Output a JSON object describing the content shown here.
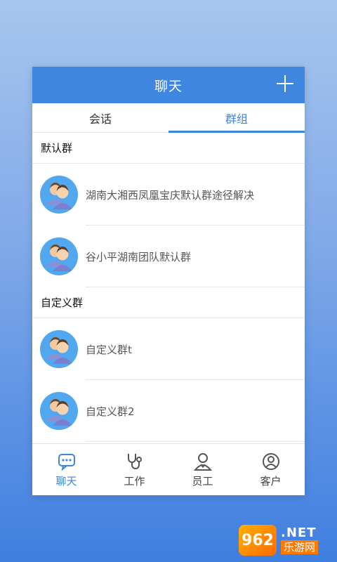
{
  "header": {
    "title": "聊天",
    "add_icon": "plus-icon"
  },
  "tabs": [
    {
      "label": "会话",
      "active": false
    },
    {
      "label": "群组",
      "active": true
    }
  ],
  "sections": [
    {
      "title": "默认群",
      "items": [
        {
          "name": "湖南大湘西凤凰宝庆默认群途径解决"
        },
        {
          "name": "谷小平湖南团队默认群"
        }
      ]
    },
    {
      "title": "自定义群",
      "items": [
        {
          "name": "自定义群t"
        },
        {
          "name": "自定义群2"
        }
      ]
    }
  ],
  "bottom_nav": [
    {
      "label": "聊天",
      "icon": "chat-bubble-icon",
      "active": true
    },
    {
      "label": "工作",
      "icon": "stethoscope-icon",
      "active": false
    },
    {
      "label": "员工",
      "icon": "staff-icon",
      "active": false
    },
    {
      "label": "客户",
      "icon": "customer-icon",
      "active": false
    }
  ],
  "colors": {
    "accent": "#3e86e0",
    "avatar_bg": "#52a8ee"
  },
  "watermark": {
    "logo": "962",
    "net": ".NET",
    "cn": "乐游网"
  }
}
